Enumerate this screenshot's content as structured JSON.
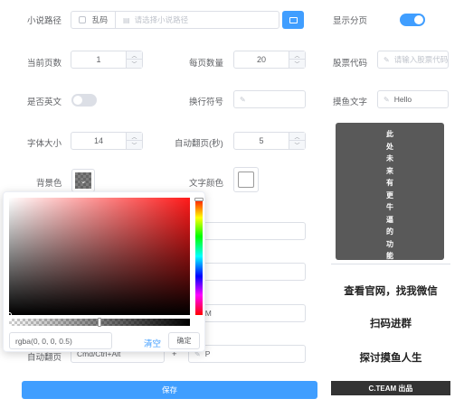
{
  "form": {
    "novel_path": {
      "label": "小说路径",
      "garbled_label": "乱码",
      "placeholder": "请选择小说路径",
      "folder_icon": "folder-icon"
    },
    "show_paging": {
      "label": "显示分页",
      "on": true
    },
    "current_page": {
      "label": "当前页数",
      "value": "1"
    },
    "per_page": {
      "label": "每页数量",
      "value": "20"
    },
    "stock_code": {
      "label": "股票代码",
      "placeholder": "请输入股票代码"
    },
    "is_english": {
      "label": "是否英文",
      "on": false
    },
    "line_break": {
      "label": "换行符号",
      "value": ""
    },
    "fish_text": {
      "label": "摸鱼文字",
      "value": "Hello"
    },
    "font_size": {
      "label": "字体大小",
      "value": "14"
    },
    "auto_page": {
      "label": "自动翻页(秒)",
      "value": "5"
    },
    "bg_color": {
      "label": "背景色"
    },
    "text_color": {
      "label": "文字颜色"
    },
    "hidden_row_3": {
      "value": "M"
    },
    "auto_page_key": {
      "label": "自动翻页",
      "value": "Cmd/Ctrl+Alt",
      "plus": "+",
      "key": "P"
    },
    "save_button": "保存"
  },
  "preview": {
    "chars": [
      "此",
      "处",
      "未",
      "来",
      "有",
      "更",
      "牛",
      "逼",
      "的",
      "功",
      "能"
    ],
    "promo_lines": [
      "查看官网，找我微信",
      "扫码进群",
      "探讨摸鱼人生"
    ],
    "footer": "C.TEAM 出品"
  },
  "color_picker": {
    "value": "rgba(0, 0, 0, 0.5)",
    "clear_label": "清空",
    "confirm_label": "确定"
  },
  "colors": {
    "primary": "#409eff",
    "switch_off": "#dcdfe6",
    "preview_bg": "#595959",
    "footer_bg": "#333333",
    "picker_hue": "#ff1a1a"
  }
}
